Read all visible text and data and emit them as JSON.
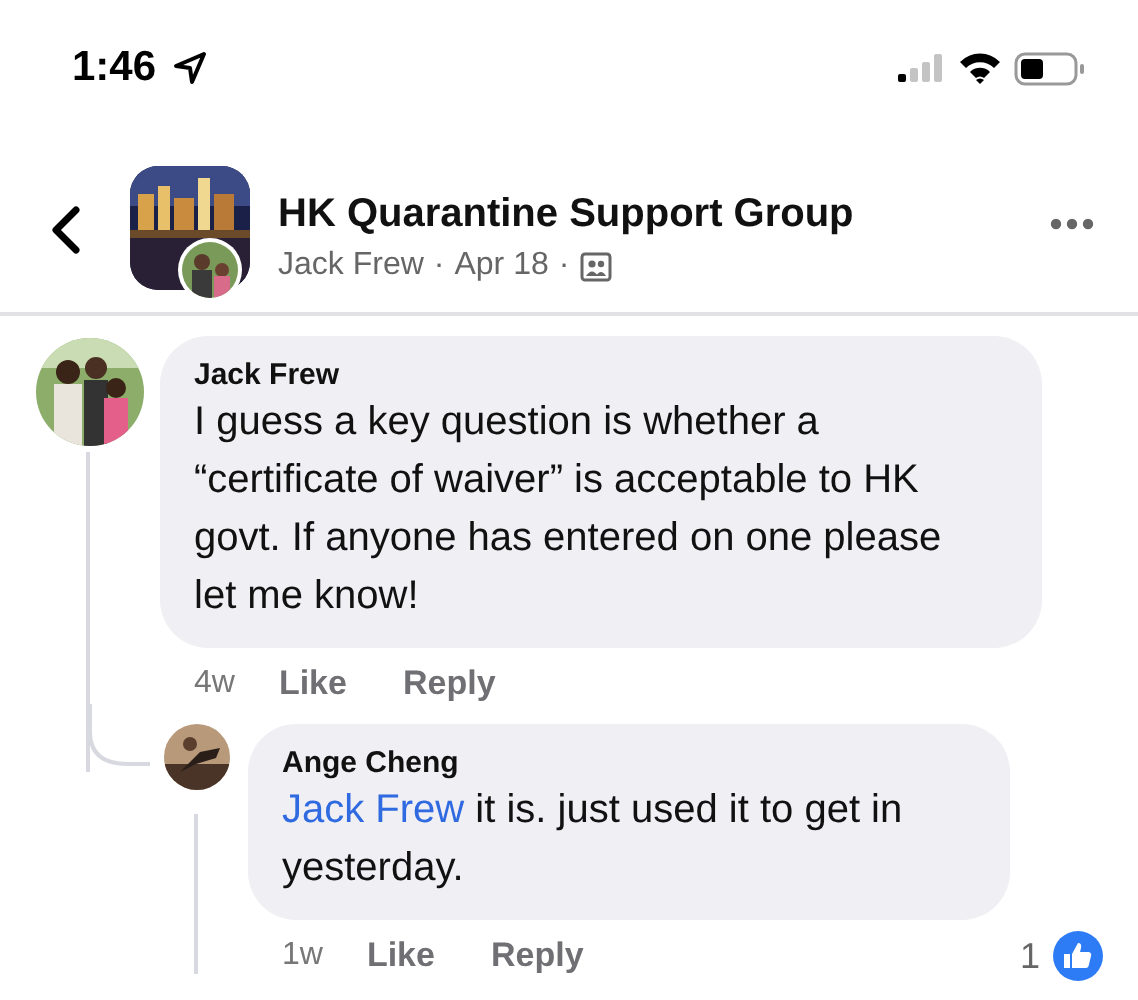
{
  "status_bar": {
    "time": "1:46"
  },
  "header": {
    "title": "HK Quarantine Support Group",
    "author": "Jack Frew",
    "date": "Apr 18",
    "separator": "·"
  },
  "comments": [
    {
      "author": "Jack Frew",
      "text": "I guess a key question is whether a “certificate of waiver” is acceptable to HK govt. If anyone has entered on one please let me know!",
      "age": "4w",
      "actions": [
        "Like",
        "Reply"
      ],
      "replies": [
        {
          "author": "Ange Cheng",
          "mention": "Jack Frew",
          "text": "it is. just used it to get in yesterday.",
          "age": "1w",
          "actions": [
            "Like",
            "Reply"
          ],
          "like_count": "1"
        }
      ]
    }
  ]
}
